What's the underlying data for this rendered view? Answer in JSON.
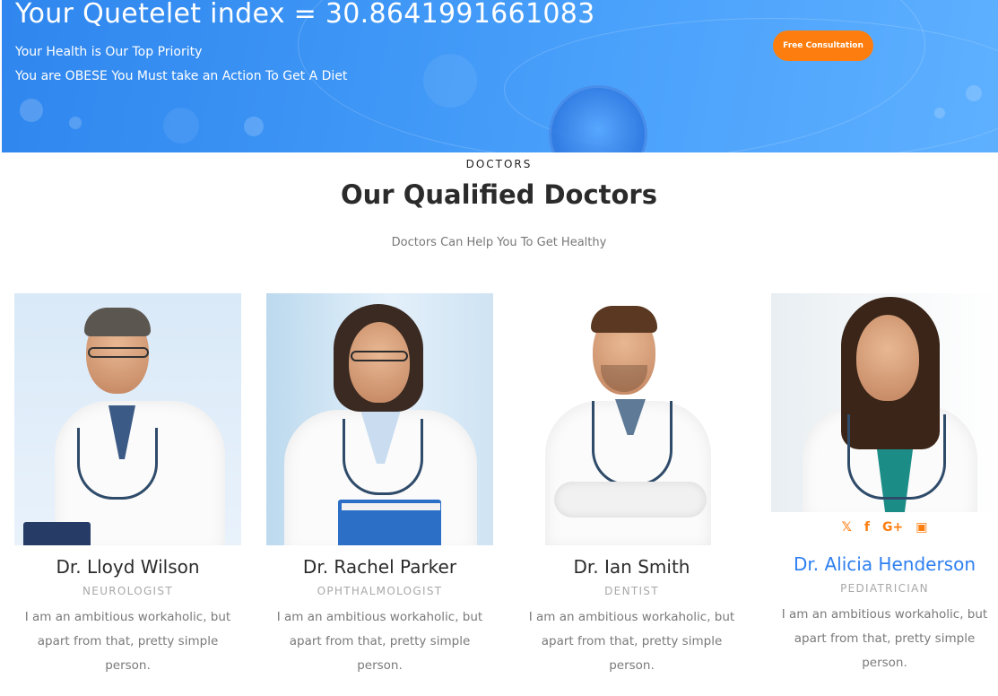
{
  "hero": {
    "title": "Your Quetelet index = 30.8641991661083",
    "subtitle": "Your Health is Our Top Priority",
    "message": "You are OBESE You Must take an Action To Get A Diet",
    "cta_label": "Free Consultation"
  },
  "section": {
    "eyebrow": "DOCTORS",
    "title": "Our Qualified Doctors",
    "subtitle": "Doctors Can Help You To Get Healthy"
  },
  "doctors": [
    {
      "name": "Dr. Lloyd Wilson",
      "specialty": "NEUROLOGIST",
      "bio": "I am an ambitious workaholic, but apart from that, pretty simple person."
    },
    {
      "name": "Dr. Rachel Parker",
      "specialty": "OPHTHALMOLOGIST",
      "bio": "I am an ambitious workaholic, but apart from that, pretty simple person."
    },
    {
      "name": "Dr. Ian Smith",
      "specialty": "DENTIST",
      "bio": "I am an ambitious workaholic, but apart from that, pretty simple person."
    },
    {
      "name": "Dr. Alicia Henderson",
      "specialty": "PEDIATRICIAN",
      "bio": "I am an ambitious workaholic, but apart from that, pretty simple person.",
      "socials": [
        "twitter-icon",
        "facebook-icon",
        "google-plus-icon",
        "instagram-icon"
      ]
    }
  ],
  "colors": {
    "accent": "#fd7e0f",
    "highlight_name": "#2f7ff0",
    "hero_blue": "#3d95f5"
  }
}
